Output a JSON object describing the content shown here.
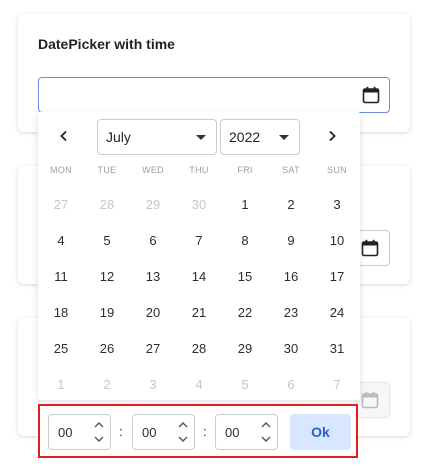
{
  "card1": {
    "title": "DatePicker with time",
    "value": ""
  },
  "calendar": {
    "month": "July",
    "year": "2022",
    "weekdays": [
      "MON",
      "TUE",
      "WED",
      "THU",
      "FRI",
      "SAT",
      "SUN"
    ],
    "weeks": [
      [
        {
          "d": "27",
          "m": true
        },
        {
          "d": "28",
          "m": true
        },
        {
          "d": "29",
          "m": true
        },
        {
          "d": "30",
          "m": true
        },
        {
          "d": "1",
          "m": false
        },
        {
          "d": "2",
          "m": false
        },
        {
          "d": "3",
          "m": false
        }
      ],
      [
        {
          "d": "4",
          "m": false
        },
        {
          "d": "5",
          "m": false
        },
        {
          "d": "6",
          "m": false
        },
        {
          "d": "7",
          "m": false
        },
        {
          "d": "8",
          "m": false
        },
        {
          "d": "9",
          "m": false
        },
        {
          "d": "10",
          "m": false
        }
      ],
      [
        {
          "d": "11",
          "m": false
        },
        {
          "d": "12",
          "m": false
        },
        {
          "d": "13",
          "m": false
        },
        {
          "d": "14",
          "m": false
        },
        {
          "d": "15",
          "m": false
        },
        {
          "d": "16",
          "m": false
        },
        {
          "d": "17",
          "m": false
        }
      ],
      [
        {
          "d": "18",
          "m": false
        },
        {
          "d": "19",
          "m": false
        },
        {
          "d": "20",
          "m": false
        },
        {
          "d": "21",
          "m": false
        },
        {
          "d": "22",
          "m": false
        },
        {
          "d": "23",
          "m": false
        },
        {
          "d": "24",
          "m": false
        }
      ],
      [
        {
          "d": "25",
          "m": false
        },
        {
          "d": "26",
          "m": false
        },
        {
          "d": "27",
          "m": false
        },
        {
          "d": "28",
          "m": false
        },
        {
          "d": "29",
          "m": false
        },
        {
          "d": "30",
          "m": false
        },
        {
          "d": "31",
          "m": false
        }
      ],
      [
        {
          "d": "1",
          "m": true
        },
        {
          "d": "2",
          "m": true
        },
        {
          "d": "3",
          "m": true
        },
        {
          "d": "4",
          "m": true
        },
        {
          "d": "5",
          "m": true
        },
        {
          "d": "6",
          "m": true
        },
        {
          "d": "7",
          "m": true
        }
      ]
    ]
  },
  "time": {
    "hours": "00",
    "minutes": "00",
    "seconds": "00",
    "separator": ":",
    "ok_label": "Ok"
  },
  "icons": {
    "calendar": "calendar-icon",
    "prev": "chevron-left-icon",
    "next": "chevron-right-icon",
    "caret": "caret-down-icon",
    "spin_up": "chevron-up-icon",
    "spin_down": "chevron-down-icon"
  },
  "colors": {
    "input_focus_border": "#6b8ce0",
    "highlight_border": "#e02020",
    "ok_bg": "#d9e6ff",
    "ok_text": "#2c5ec9",
    "muted_day": "#c4c7cc"
  }
}
